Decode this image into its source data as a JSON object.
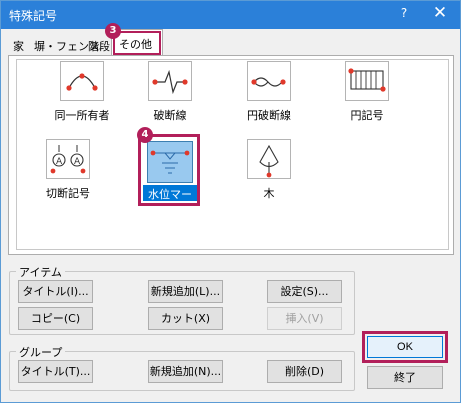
{
  "window": {
    "title": "特殊記号",
    "help_label": "?",
    "close_label": "✕"
  },
  "tabs": [
    {
      "label": "家"
    },
    {
      "label": "塀・フェンス"
    },
    {
      "label": "階段"
    },
    {
      "label": "その他",
      "selected": true
    }
  ],
  "symbols": [
    {
      "label": "同一所有者",
      "icon": "same-owner-arc-icon"
    },
    {
      "label": "破断線",
      "icon": "break-line-icon"
    },
    {
      "label": "円破断線",
      "icon": "circular-break-line-icon"
    },
    {
      "label": "円記号",
      "icon": "hatched-symbol-icon"
    },
    {
      "label": "切断記号",
      "icon": "section-mark-icon"
    },
    {
      "label": "水位マーク",
      "icon": "water-level-mark-icon",
      "selected": true
    },
    {
      "label": "木",
      "icon": "tree-icon"
    }
  ],
  "callouts": {
    "step3": "3",
    "step4": "4"
  },
  "item_group": {
    "label": "アイテム",
    "buttons": {
      "title": "タイトル(I)...",
      "new_add": "新規追加(L)...",
      "settings": "設定(S)...",
      "copy": "コピー(C)",
      "cut": "カット(X)",
      "insert": "挿入(V)"
    }
  },
  "group_group": {
    "label": "グループ",
    "buttons": {
      "title": "タイトル(T)...",
      "new_add": "新規追加(N)...",
      "delete": "削除(D)"
    }
  },
  "dialog_buttons": {
    "ok": "OK",
    "exit": "終了"
  },
  "colors": {
    "titlebar": "#2b80d9",
    "highlight": "#b21f5a",
    "selection": "#0078d7",
    "point_red": "#e0392b"
  }
}
